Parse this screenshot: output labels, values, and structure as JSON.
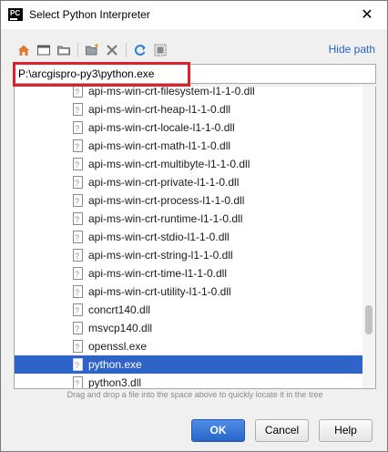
{
  "window": {
    "title": "Select Python Interpreter",
    "app_icon_text": "PC",
    "close_glyph": "✕"
  },
  "toolbar": {
    "icons": [
      "home-icon",
      "desktop-icon",
      "project-icon",
      "new-folder-icon",
      "delete-icon",
      "refresh-icon",
      "show-hidden-icon"
    ],
    "hide_path_label": "Hide path"
  },
  "path": {
    "value": "P:\\arcgispro-py3\\python.exe"
  },
  "tree": {
    "items": [
      {
        "label": "api-ms-win-crt-filesystem-l1-1-0.dll"
      },
      {
        "label": "api-ms-win-crt-heap-l1-1-0.dll"
      },
      {
        "label": "api-ms-win-crt-locale-l1-1-0.dll"
      },
      {
        "label": "api-ms-win-crt-math-l1-1-0.dll"
      },
      {
        "label": "api-ms-win-crt-multibyte-l1-1-0.dll"
      },
      {
        "label": "api-ms-win-crt-private-l1-1-0.dll"
      },
      {
        "label": "api-ms-win-crt-process-l1-1-0.dll"
      },
      {
        "label": "api-ms-win-crt-runtime-l1-1-0.dll"
      },
      {
        "label": "api-ms-win-crt-stdio-l1-1-0.dll"
      },
      {
        "label": "api-ms-win-crt-string-l1-1-0.dll"
      },
      {
        "label": "api-ms-win-crt-time-l1-1-0.dll"
      },
      {
        "label": "api-ms-win-crt-utility-l1-1-0.dll"
      },
      {
        "label": "concrt140.dll"
      },
      {
        "label": "msvcp140.dll"
      },
      {
        "label": "openssl.exe"
      },
      {
        "label": "python.exe",
        "selected": true
      },
      {
        "label": "python3.dll"
      }
    ]
  },
  "hint": "Drag and drop a file into the space above to quickly locate it in the tree",
  "buttons": {
    "ok": "OK",
    "cancel": "Cancel",
    "help": "Help"
  },
  "colors": {
    "selection": "#2e64c8",
    "link": "#2a62c9",
    "highlight_box": "#e0202a",
    "primary_button": "#2a66c8"
  }
}
